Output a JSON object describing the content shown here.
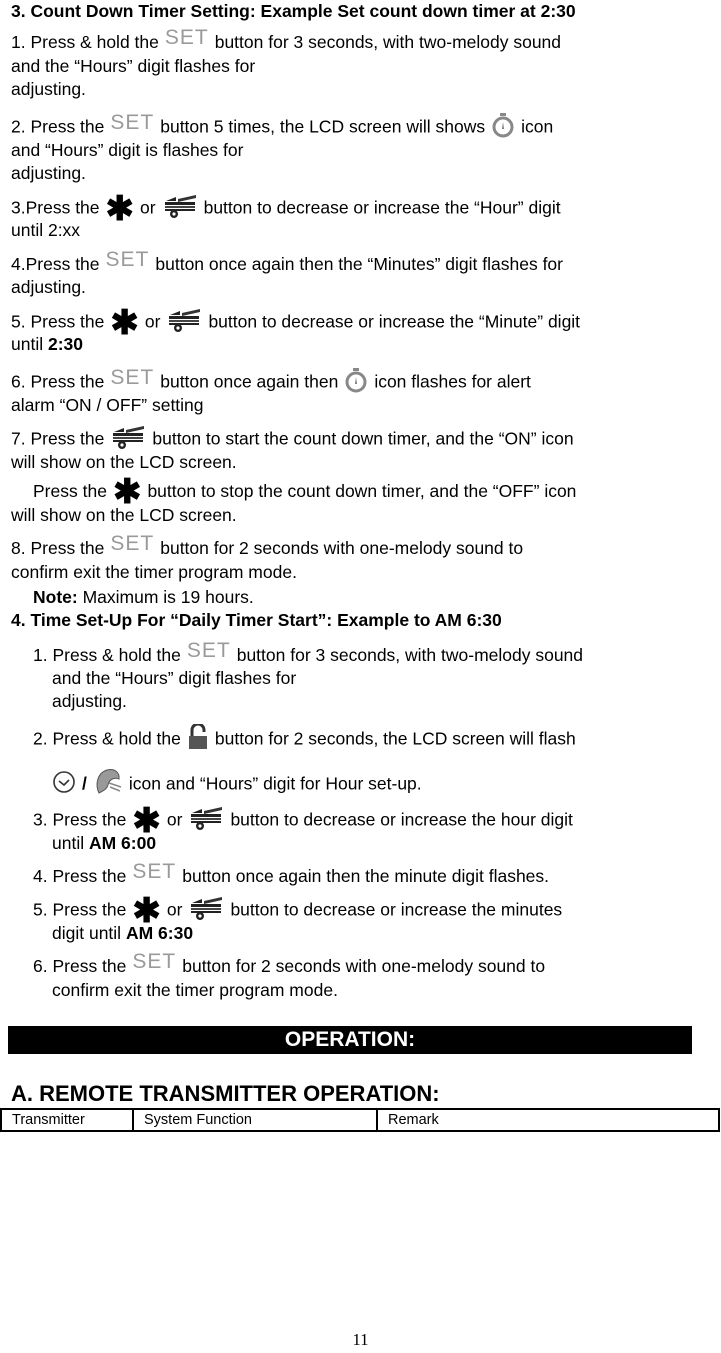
{
  "section3": {
    "heading": "3. Count Down Timer Setting: Example Set count down timer at 2:30",
    "steps": [
      {
        "a": "1. Press & hold the",
        "b": "button for 3 seconds, with two-melody sound",
        "c": "and the “Hours” digit flashes for",
        "d": "adjusting."
      },
      {
        "a": "2. Press the",
        "b": "button 5 times, the LCD screen will shows",
        "b2": "icon",
        "c": "and “Hours” digit is flashes for",
        "d": "adjusting."
      },
      {
        "a": "3.Press the",
        "or": "or",
        "b": "button to decrease or increase the “Hour” digit",
        "c": "until 2:xx"
      },
      {
        "a": "4.Press the",
        "b": "button once again then the “Minutes” digit flashes for",
        "c": "adjusting."
      },
      {
        "a": "5. Press the",
        "or": "or",
        "b": "button to decrease or increase the “Minute” digit",
        "c": "until",
        "c_bold": "2:30"
      },
      {
        "a": "6. Press the",
        "b": "button once again then",
        "b2": "icon flashes for alert",
        "c": "alarm    “ON / OFF” setting"
      },
      {
        "a": "7. Press the",
        "b": "button to start the count down timer, and the “ON” icon",
        "c": "will show on the LCD screen."
      },
      {
        "a": "Press the",
        "b": "button to stop the count down timer, and the “OFF” icon",
        "c": "will show on the LCD screen."
      },
      {
        "a": "8. Press the",
        "b": "button for 2 seconds with one-melody sound to",
        "c": "confirm exit the timer program mode."
      }
    ],
    "note_label": "Note:",
    "note_text": "Maximum is 19 hours."
  },
  "section4": {
    "heading": "4. Time Set-Up For “Daily Timer Start”: Example to AM 6:30",
    "steps": [
      {
        "a": "1. Press & hold the",
        "b": "button for 3 seconds, with two-melody sound",
        "c": "and the “Hours” digit flashes for",
        "d": "adjusting."
      },
      {
        "a": "2. Press & hold the",
        "b": "button for 2 seconds, the LCD screen will flash",
        "slash": "/",
        "c": "icon and “Hours” digit for Hour set-up."
      },
      {
        "a": "3. Press the",
        "or": "or",
        "b": "button to decrease or increase the hour digit",
        "c": "until",
        "c_bold": "AM 6:00"
      },
      {
        "a": "4. Press the",
        "b": "button once again then the minute digit flashes."
      },
      {
        "a": "5. Press the",
        "or": "or",
        "b": "button to decrease or increase the minutes",
        "c": "digit until",
        "c_bold": "AM 6:30"
      },
      {
        "a": "6. Press the",
        "b": "button for 2 seconds with one-melody sound to",
        "c": "confirm exit the timer program mode."
      }
    ]
  },
  "icons": {
    "set": "SET",
    "star": "✱"
  },
  "operation_banner": "OPERATION:",
  "remote_heading": "A.  REMOTE TRANSMITTER OPERATION:",
  "table": {
    "headers": [
      "Transmitter",
      "System Function",
      "Remark"
    ]
  },
  "page_number": "11"
}
